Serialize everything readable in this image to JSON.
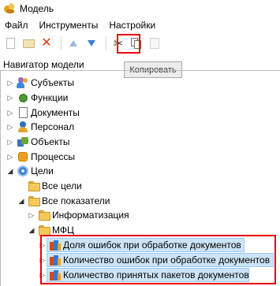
{
  "window": {
    "title": "Модель",
    "icon": "app-leaf-icon"
  },
  "menu": {
    "items": [
      "Файл",
      "Инструменты",
      "Настройки"
    ]
  },
  "toolbar": {
    "buttons": [
      {
        "icon": "new-icon"
      },
      {
        "icon": "open-folder-icon"
      },
      {
        "icon": "delete-icon"
      },
      {
        "icon": "move-up-icon"
      },
      {
        "icon": "move-down-icon"
      },
      {
        "icon": "cut-icon"
      },
      {
        "icon": "copy-icon"
      },
      {
        "icon": "paste-icon"
      }
    ],
    "tooltip": "Копировать"
  },
  "navigator": {
    "header": "Навигатор модели",
    "items": [
      {
        "label": "Субъекты",
        "icon": "people-icon",
        "expanded": false
      },
      {
        "label": "Функции",
        "icon": "gear-icon",
        "expanded": false
      },
      {
        "label": "Документы",
        "icon": "document-icon",
        "expanded": false
      },
      {
        "label": "Персонал",
        "icon": "person-icon",
        "expanded": false
      },
      {
        "label": "Объекты",
        "icon": "objects-icon",
        "expanded": false
      },
      {
        "label": "Процессы",
        "icon": "process-icon",
        "expanded": false
      },
      {
        "label": "Цели",
        "icon": "goal-icon",
        "expanded": true
      },
      {
        "label": "Все цели",
        "icon": "folder-icon"
      },
      {
        "label": "Все показатели",
        "icon": "folder-icon",
        "expanded": true
      },
      {
        "label": "Информатизация",
        "icon": "folder-icon",
        "expanded": false
      },
      {
        "label": "МФЦ",
        "icon": "folder-icon",
        "expanded": true
      },
      {
        "label": "Доля ошибок при обработке документов",
        "icon": "indicator-icon",
        "selected": true
      },
      {
        "label": "Количество ошибок при обработке документов",
        "icon": "indicator-icon",
        "selected": true
      },
      {
        "label": "Количество принятых пакетов документов",
        "icon": "indicator-icon",
        "selected": true
      }
    ]
  },
  "colors": {
    "highlight_red": "#e8000b",
    "selection_blue": "#cce4f7"
  }
}
